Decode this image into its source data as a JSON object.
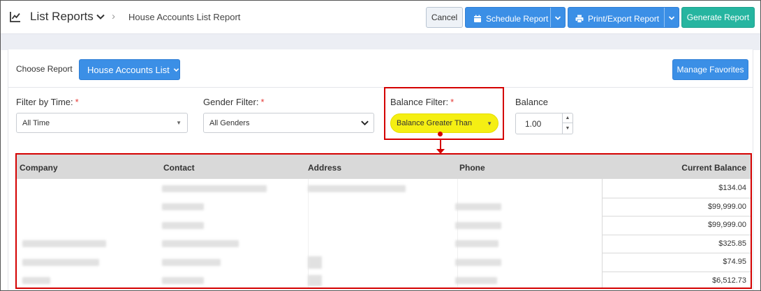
{
  "header": {
    "title": "List Reports",
    "breadcrumb": "House Accounts List Report",
    "buttons": {
      "cancel": "Cancel",
      "schedule": "Schedule Report",
      "print": "Print/Export Report",
      "generate": "Generate Report"
    }
  },
  "report": {
    "choose_label": "Choose Report",
    "selected": "House Accounts List",
    "favorites": "Manage Favorites"
  },
  "filters": {
    "time": {
      "label": "Filter by Time:",
      "required": "*",
      "value": "All Time"
    },
    "gender": {
      "label": "Gender Filter:",
      "required": "*",
      "value": "All Genders"
    },
    "balance_filter": {
      "label": "Balance Filter:",
      "required": "*",
      "value": "Balance Greater Than"
    },
    "balance": {
      "label": "Balance",
      "value": "1.00"
    }
  },
  "table": {
    "columns": [
      "Company",
      "Contact",
      "Address",
      "Phone",
      "Current Balance"
    ],
    "balances": [
      "$134.04",
      "$99,999.00",
      "$99,999.00",
      "$325.85",
      "$74.95",
      "$6,512.73"
    ]
  },
  "colors": {
    "primary": "#3b8fe6",
    "teal": "#26b5a0",
    "highlight": "#f5ef13",
    "callout": "#d40000"
  }
}
